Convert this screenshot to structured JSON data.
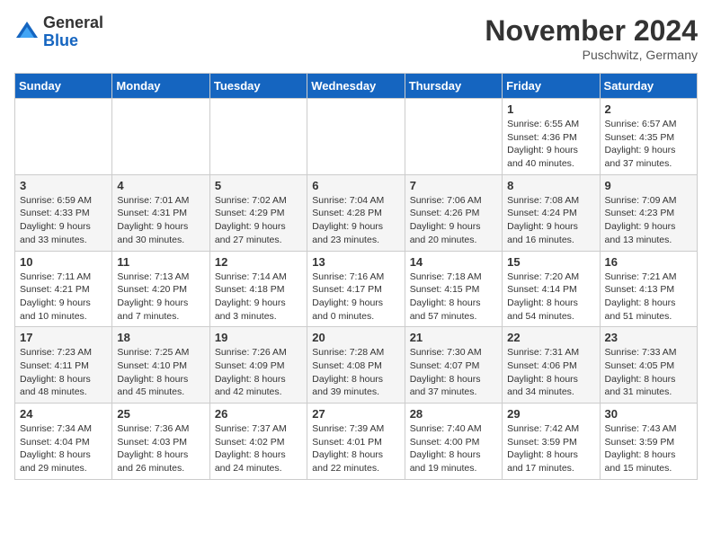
{
  "logo": {
    "general": "General",
    "blue": "Blue"
  },
  "title": "November 2024",
  "location": "Puschwitz, Germany",
  "weekdays": [
    "Sunday",
    "Monday",
    "Tuesday",
    "Wednesday",
    "Thursday",
    "Friday",
    "Saturday"
  ],
  "weeks": [
    [
      {
        "day": "",
        "info": ""
      },
      {
        "day": "",
        "info": ""
      },
      {
        "day": "",
        "info": ""
      },
      {
        "day": "",
        "info": ""
      },
      {
        "day": "",
        "info": ""
      },
      {
        "day": "1",
        "info": "Sunrise: 6:55 AM\nSunset: 4:36 PM\nDaylight: 9 hours\nand 40 minutes."
      },
      {
        "day": "2",
        "info": "Sunrise: 6:57 AM\nSunset: 4:35 PM\nDaylight: 9 hours\nand 37 minutes."
      }
    ],
    [
      {
        "day": "3",
        "info": "Sunrise: 6:59 AM\nSunset: 4:33 PM\nDaylight: 9 hours\nand 33 minutes."
      },
      {
        "day": "4",
        "info": "Sunrise: 7:01 AM\nSunset: 4:31 PM\nDaylight: 9 hours\nand 30 minutes."
      },
      {
        "day": "5",
        "info": "Sunrise: 7:02 AM\nSunset: 4:29 PM\nDaylight: 9 hours\nand 27 minutes."
      },
      {
        "day": "6",
        "info": "Sunrise: 7:04 AM\nSunset: 4:28 PM\nDaylight: 9 hours\nand 23 minutes."
      },
      {
        "day": "7",
        "info": "Sunrise: 7:06 AM\nSunset: 4:26 PM\nDaylight: 9 hours\nand 20 minutes."
      },
      {
        "day": "8",
        "info": "Sunrise: 7:08 AM\nSunset: 4:24 PM\nDaylight: 9 hours\nand 16 minutes."
      },
      {
        "day": "9",
        "info": "Sunrise: 7:09 AM\nSunset: 4:23 PM\nDaylight: 9 hours\nand 13 minutes."
      }
    ],
    [
      {
        "day": "10",
        "info": "Sunrise: 7:11 AM\nSunset: 4:21 PM\nDaylight: 9 hours\nand 10 minutes."
      },
      {
        "day": "11",
        "info": "Sunrise: 7:13 AM\nSunset: 4:20 PM\nDaylight: 9 hours\nand 7 minutes."
      },
      {
        "day": "12",
        "info": "Sunrise: 7:14 AM\nSunset: 4:18 PM\nDaylight: 9 hours\nand 3 minutes."
      },
      {
        "day": "13",
        "info": "Sunrise: 7:16 AM\nSunset: 4:17 PM\nDaylight: 9 hours\nand 0 minutes."
      },
      {
        "day": "14",
        "info": "Sunrise: 7:18 AM\nSunset: 4:15 PM\nDaylight: 8 hours\nand 57 minutes."
      },
      {
        "day": "15",
        "info": "Sunrise: 7:20 AM\nSunset: 4:14 PM\nDaylight: 8 hours\nand 54 minutes."
      },
      {
        "day": "16",
        "info": "Sunrise: 7:21 AM\nSunset: 4:13 PM\nDaylight: 8 hours\nand 51 minutes."
      }
    ],
    [
      {
        "day": "17",
        "info": "Sunrise: 7:23 AM\nSunset: 4:11 PM\nDaylight: 8 hours\nand 48 minutes."
      },
      {
        "day": "18",
        "info": "Sunrise: 7:25 AM\nSunset: 4:10 PM\nDaylight: 8 hours\nand 45 minutes."
      },
      {
        "day": "19",
        "info": "Sunrise: 7:26 AM\nSunset: 4:09 PM\nDaylight: 8 hours\nand 42 minutes."
      },
      {
        "day": "20",
        "info": "Sunrise: 7:28 AM\nSunset: 4:08 PM\nDaylight: 8 hours\nand 39 minutes."
      },
      {
        "day": "21",
        "info": "Sunrise: 7:30 AM\nSunset: 4:07 PM\nDaylight: 8 hours\nand 37 minutes."
      },
      {
        "day": "22",
        "info": "Sunrise: 7:31 AM\nSunset: 4:06 PM\nDaylight: 8 hours\nand 34 minutes."
      },
      {
        "day": "23",
        "info": "Sunrise: 7:33 AM\nSunset: 4:05 PM\nDaylight: 8 hours\nand 31 minutes."
      }
    ],
    [
      {
        "day": "24",
        "info": "Sunrise: 7:34 AM\nSunset: 4:04 PM\nDaylight: 8 hours\nand 29 minutes."
      },
      {
        "day": "25",
        "info": "Sunrise: 7:36 AM\nSunset: 4:03 PM\nDaylight: 8 hours\nand 26 minutes."
      },
      {
        "day": "26",
        "info": "Sunrise: 7:37 AM\nSunset: 4:02 PM\nDaylight: 8 hours\nand 24 minutes."
      },
      {
        "day": "27",
        "info": "Sunrise: 7:39 AM\nSunset: 4:01 PM\nDaylight: 8 hours\nand 22 minutes."
      },
      {
        "day": "28",
        "info": "Sunrise: 7:40 AM\nSunset: 4:00 PM\nDaylight: 8 hours\nand 19 minutes."
      },
      {
        "day": "29",
        "info": "Sunrise: 7:42 AM\nSunset: 3:59 PM\nDaylight: 8 hours\nand 17 minutes."
      },
      {
        "day": "30",
        "info": "Sunrise: 7:43 AM\nSunset: 3:59 PM\nDaylight: 8 hours\nand 15 minutes."
      }
    ]
  ]
}
